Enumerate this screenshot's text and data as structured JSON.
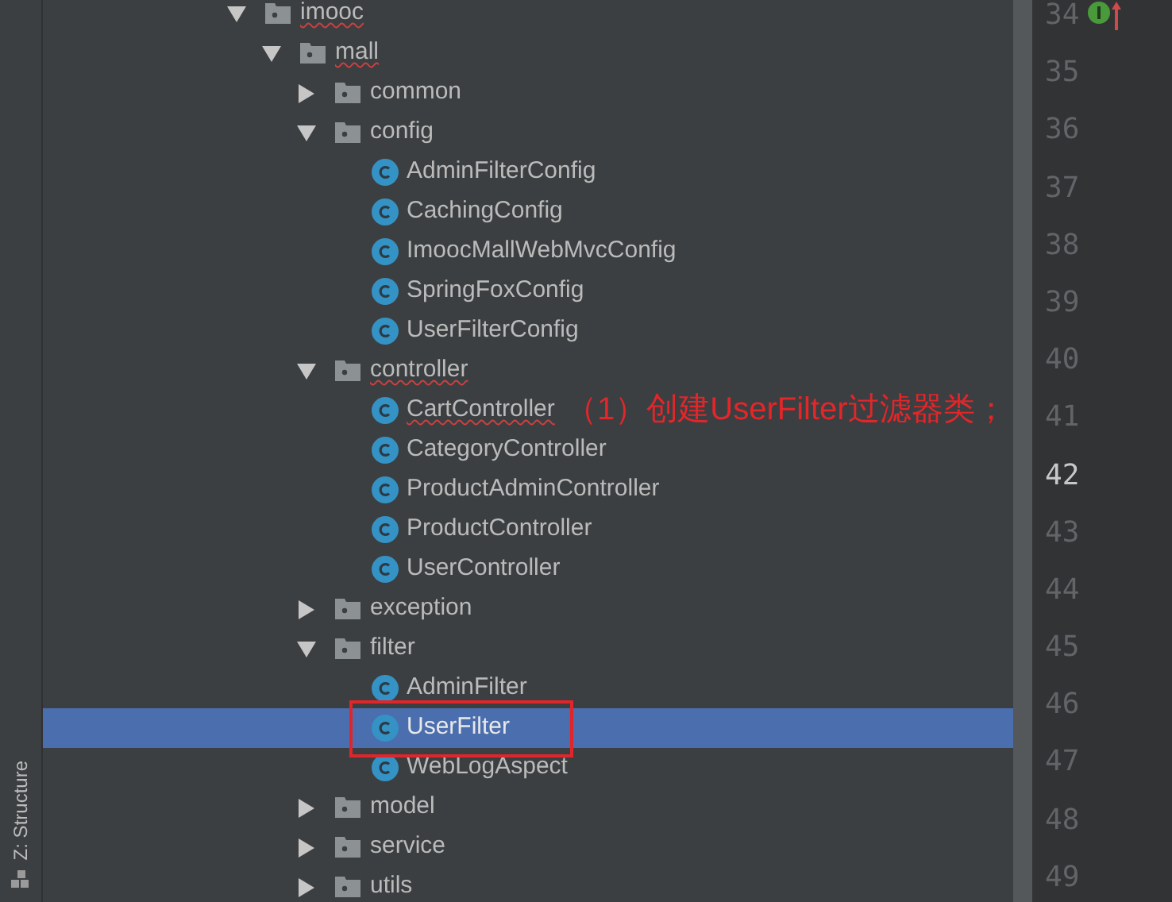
{
  "tool_window": {
    "label": "Z: Structure"
  },
  "tree": [
    {
      "name": "imooc",
      "kind": "package",
      "expanded": true,
      "misspelled": true,
      "selected": false,
      "children": [
        {
          "name": "mall",
          "kind": "package",
          "expanded": true,
          "misspelled": true,
          "selected": false,
          "children": [
            {
              "name": "common",
              "kind": "package",
              "expanded": false,
              "selected": false
            },
            {
              "name": "config",
              "kind": "package",
              "expanded": true,
              "selected": false,
              "children": [
                {
                  "name": "AdminFilterConfig",
                  "kind": "class",
                  "selected": false
                },
                {
                  "name": "CachingConfig",
                  "kind": "class",
                  "selected": false
                },
                {
                  "name": "ImoocMallWebMvcConfig",
                  "kind": "class",
                  "selected": false
                },
                {
                  "name": "SpringFoxConfig",
                  "kind": "class",
                  "selected": false
                },
                {
                  "name": "UserFilterConfig",
                  "kind": "class",
                  "selected": false
                }
              ]
            },
            {
              "name": "controller",
              "kind": "package",
              "expanded": true,
              "misspelled": true,
              "selected": false,
              "children": [
                {
                  "name": "CartController",
                  "kind": "class",
                  "misspelled": true,
                  "selected": false
                },
                {
                  "name": "CategoryController",
                  "kind": "class",
                  "selected": false
                },
                {
                  "name": "ProductAdminController",
                  "kind": "class",
                  "selected": false
                },
                {
                  "name": "ProductController",
                  "kind": "class",
                  "selected": false
                },
                {
                  "name": "UserController",
                  "kind": "class",
                  "selected": false
                }
              ]
            },
            {
              "name": "exception",
              "kind": "package",
              "expanded": false,
              "selected": false
            },
            {
              "name": "filter",
              "kind": "package",
              "expanded": true,
              "selected": false,
              "children": [
                {
                  "name": "AdminFilter",
                  "kind": "class",
                  "selected": false
                },
                {
                  "name": "UserFilter",
                  "kind": "class",
                  "selected": true,
                  "boxed": true
                },
                {
                  "name": "WebLogAspect",
                  "kind": "class",
                  "selected": false
                }
              ]
            },
            {
              "name": "model",
              "kind": "package",
              "expanded": false,
              "selected": false
            },
            {
              "name": "service",
              "kind": "package",
              "expanded": false,
              "selected": false
            },
            {
              "name": "utils",
              "kind": "package",
              "expanded": false,
              "selected": false
            }
          ]
        }
      ]
    }
  ],
  "annotation": {
    "text": "（1）创建UserFilter过滤器类；"
  },
  "gutter": {
    "lines": [
      {
        "number": "34",
        "current": false,
        "kind": "implements"
      },
      {
        "number": "35",
        "current": false,
        "kind": "plain"
      },
      {
        "number": "36",
        "current": false,
        "kind": "plain"
      },
      {
        "number": "37",
        "current": false,
        "kind": "plain"
      },
      {
        "number": "38",
        "current": false,
        "kind": "plain"
      },
      {
        "number": "39",
        "current": false,
        "kind": "plain"
      },
      {
        "number": "40",
        "current": false,
        "kind": "plain"
      },
      {
        "number": "41",
        "current": false,
        "kind": "plain"
      },
      {
        "number": "42",
        "current": true,
        "kind": "plain"
      },
      {
        "number": "43",
        "current": false,
        "kind": "plain"
      },
      {
        "number": "44",
        "current": false,
        "kind": "plain"
      },
      {
        "number": "45",
        "current": false,
        "kind": "plain"
      },
      {
        "number": "46",
        "current": false,
        "kind": "plain"
      },
      {
        "number": "47",
        "current": false,
        "kind": "plain"
      },
      {
        "number": "48",
        "current": false,
        "kind": "plain"
      },
      {
        "number": "49",
        "current": false,
        "kind": "plain"
      }
    ]
  }
}
